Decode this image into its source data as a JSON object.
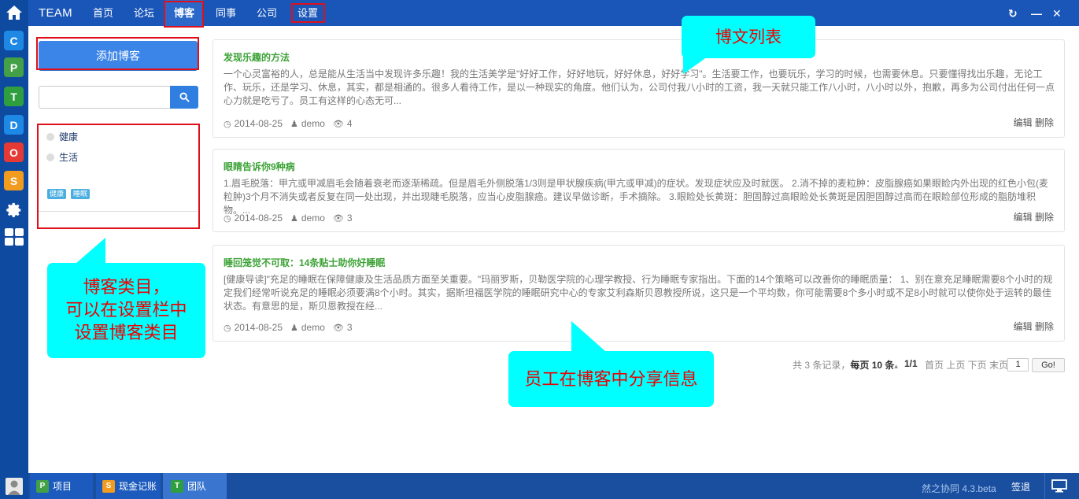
{
  "app": {
    "brand": "TEAM"
  },
  "nav": [
    {
      "label": "首页",
      "active": false
    },
    {
      "label": "论坛",
      "active": false
    },
    {
      "label": "博客",
      "active": true
    },
    {
      "label": "同事",
      "active": false
    },
    {
      "label": "公司",
      "active": false
    },
    {
      "label": "设置",
      "active": false
    }
  ],
  "rail": [
    {
      "name": "rail-c-icon",
      "glyph": "C",
      "color": "#1e88e5"
    },
    {
      "name": "rail-p-icon",
      "glyph": "P",
      "color": "#43a047"
    },
    {
      "name": "rail-t-icon",
      "glyph": "T",
      "color": "#2e9e3e"
    },
    {
      "name": "rail-d-icon",
      "glyph": "D",
      "color": "#1e88e5"
    },
    {
      "name": "rail-o-icon",
      "glyph": "O",
      "color": "#e53935"
    },
    {
      "name": "rail-s-icon",
      "glyph": "S",
      "color": "#f29c1f"
    }
  ],
  "sidebar": {
    "add_label": "添加博客",
    "categories": [
      "健康",
      "生活"
    ],
    "tags": [
      "健康",
      "睡眠"
    ]
  },
  "posts": [
    {
      "title": "发现乐趣的方法",
      "body": "一个心灵富裕的人，总是能从生活当中发现许多乐趣！我的生活美学是\"好好工作，好好地玩，好好休息，好好学习\"。生活要工作，也要玩乐，学习的时候，也需要休息。只要懂得找出乐趣，无论工作、玩乐，还是学习、休息，其实，都是相通的。很多人看待工作，是以一种现实的角度。他们认为，公司付我八小时的工资，我一天就只能工作八小时，八小时以外，抱歉，再多为公司付出任何一点心力就是吃亏了。员工有这样的心态无可...",
      "date": "2014-08-25",
      "author": "demo",
      "views": "4",
      "edit": "编辑",
      "delete": "删除"
    },
    {
      "title": "眼睛告诉你9种病",
      "body": "1.眉毛脱落：甲亢或甲减眉毛会随着衰老而逐渐稀疏。但是眉毛外侧脱落1/3则是甲状腺疾病(甲亢或甲减)的症状。发现症状应及时就医。 2.消不掉的麦粒肿：皮脂腺癌如果眼睑内外出现的红色小包(麦粒肿)3个月不消失或者反复在同一处出现，并出现睫毛脱落，应当心皮脂腺癌。建议早做诊断，手术摘除。 3.眼睑处长黄斑：胆固醇过高眼睑处长黄斑是因胆固醇过高而在眼睑部位形成的脂肪堆积物。...",
      "date": "2014-08-25",
      "author": "demo",
      "views": "3",
      "edit": "编辑",
      "delete": "删除"
    },
    {
      "title": "睡回笼觉不可取：14条贴士助你好睡眠",
      "body": "[健康导读]\"充足的睡眠在保障健康及生活品质方面至关重要。\"玛丽罗斯，贝勒医学院的心理学教授、行为睡眠专家指出。下面的14个策略可以改善你的睡眠质量： 1、别在意充足睡眠需要8个小时的规定我们经常听说充足的睡眠必须要满8个小时。其实，据斯坦福医学院的睡眠研究中心的专家艾利森斯贝恩教授所说，这只是一个平均数，你可能需要8个多小时或不足8小时就可以使你处于运转的最佳状态。有意思的是，斯贝恩教授在经...",
      "date": "2014-08-25",
      "author": "demo",
      "views": "3",
      "edit": "编辑",
      "delete": "删除"
    }
  ],
  "pager": {
    "total": "共 3 条记录，",
    "per_page_label": "每页",
    "per_page_value": "10",
    "per_page_unit": "条",
    "page_status": "1/1",
    "links": "首页 上页 下页 末页",
    "input_value": "1",
    "go_label": "Go!"
  },
  "callouts": {
    "list": "博文列表",
    "category_l1": "博客类目，",
    "category_l2": "可以在设置栏中",
    "category_l3": "设置博客类目",
    "share": "员工在博客中分享信息"
  },
  "taskbar": {
    "items": [
      {
        "label": "项目",
        "glyph": "P",
        "color": "#43a047"
      },
      {
        "label": "现金记账",
        "glyph": "S",
        "color": "#f29c1f"
      },
      {
        "label": "团队",
        "glyph": "T",
        "color": "#2e9e3e",
        "active": true
      }
    ],
    "version": "然之协同 4.3.beta",
    "signout": "签退"
  },
  "colors": {
    "topbar": "#1a56b8",
    "rail": "#0f4aa1",
    "accent": "#3b84e8",
    "title_green": "#3ca236",
    "callout": "#00ffff",
    "highlight": "#e0101a"
  }
}
